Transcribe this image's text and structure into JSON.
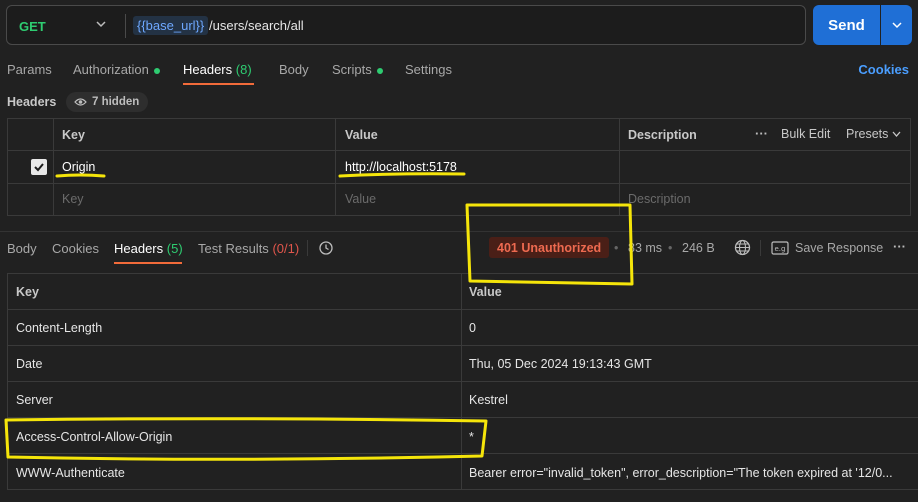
{
  "request": {
    "method": "GET",
    "url_variable": "{{base_url}}",
    "url_path": "/users/search/all",
    "send_label": "Send"
  },
  "request_tabs": [
    {
      "label": "Params"
    },
    {
      "label": "Authorization"
    },
    {
      "label": "Headers",
      "count": "(8)"
    },
    {
      "label": "Body"
    },
    {
      "label": "Scripts"
    },
    {
      "label": "Settings"
    }
  ],
  "cookies_link": "Cookies",
  "headers_section": {
    "label": "Headers",
    "hidden_label": "7 hidden"
  },
  "request_headers_table": {
    "columns": [
      "Key",
      "Value",
      "Description"
    ],
    "bulk_edit": "Bulk Edit",
    "presets": "Presets",
    "rows": [
      {
        "key": "Origin",
        "value": "http://localhost:5178",
        "checked": true
      }
    ],
    "placeholders": {
      "key": "Key",
      "value": "Value",
      "description": "Description"
    }
  },
  "response_tabs": [
    {
      "label": "Body"
    },
    {
      "label": "Cookies"
    },
    {
      "label": "Headers",
      "count": "(5)"
    },
    {
      "label": "Test Results",
      "count": "(0/1)"
    }
  ],
  "response_meta": {
    "status": "401 Unauthorized",
    "time": "83 ms",
    "size": "246 B",
    "save_response": "Save Response"
  },
  "response_headers_table": {
    "columns": [
      "Key",
      "Value"
    ],
    "rows": [
      {
        "key": "Content-Length",
        "value": "0"
      },
      {
        "key": "Date",
        "value": "Thu, 05 Dec 2024 19:13:43 GMT"
      },
      {
        "key": "Server",
        "value": "Kestrel"
      },
      {
        "key": "Access-Control-Allow-Origin",
        "value": "*"
      },
      {
        "key": "WWW-Authenticate",
        "value": "Bearer error=\"invalid_token\", error_description=\"The token expired at '12/0..."
      }
    ]
  },
  "colors": {
    "background": "#212121",
    "accent_send": "#1f6fd6",
    "method_get": "#2ecc71",
    "status_error": "#ee6a50",
    "annotation": "#f5e50a"
  }
}
